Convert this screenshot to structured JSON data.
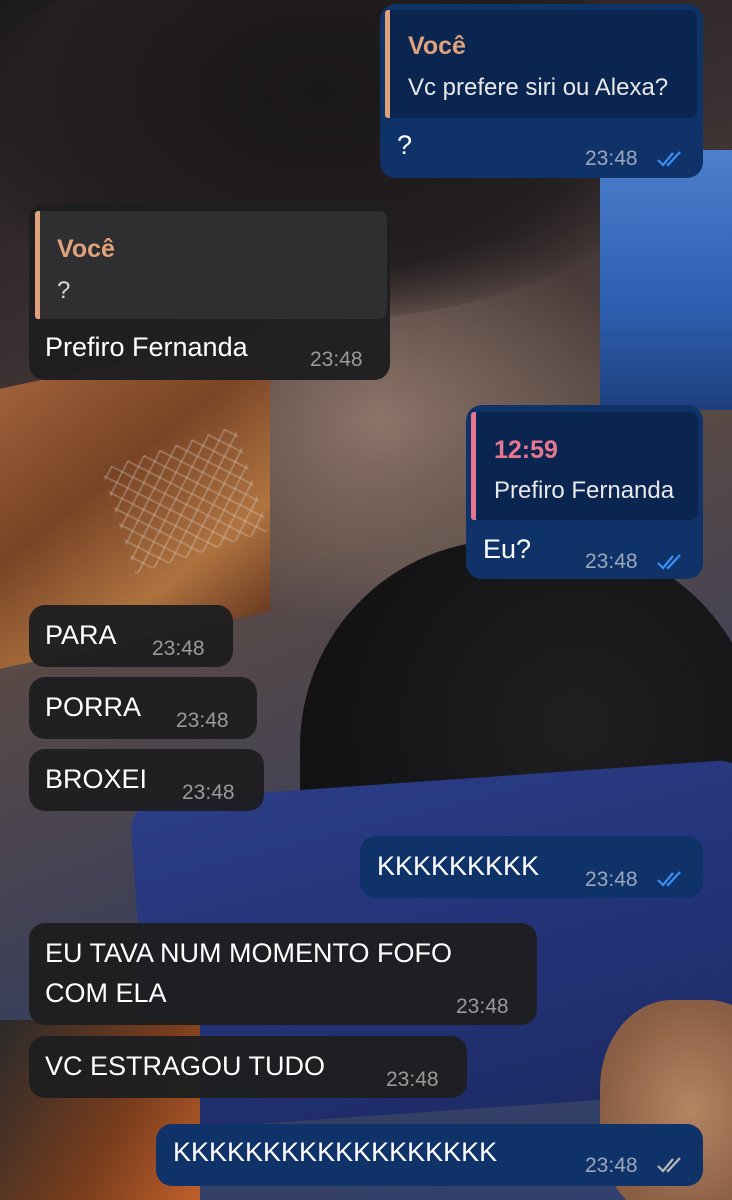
{
  "colors": {
    "incoming_bubble": "#1e1e20",
    "outgoing_bubble": "#0f3268",
    "quote_name_voce": "#e0a27a",
    "quote_name_time": "#e8768f",
    "read_ticks": "#3a8ff7",
    "delivered_ticks": "#b8b8b8"
  },
  "messages": [
    {
      "direction": "outgoing",
      "reply": {
        "name": "Você",
        "text": "Vc prefere siri ou Alexa?"
      },
      "text": "?",
      "time": "23:48",
      "status": "read"
    },
    {
      "direction": "incoming",
      "reply": {
        "name": "Você",
        "text": "?"
      },
      "text": "Prefiro Fernanda",
      "time": "23:48"
    },
    {
      "direction": "outgoing",
      "reply": {
        "name": "12:59",
        "text": "Prefiro Fernanda"
      },
      "text": "Eu?",
      "time": "23:48",
      "status": "read"
    },
    {
      "direction": "incoming",
      "text": "PARA",
      "time": "23:48"
    },
    {
      "direction": "incoming",
      "text": "PORRA",
      "time": "23:48"
    },
    {
      "direction": "incoming",
      "text": "BROXEI",
      "time": "23:48"
    },
    {
      "direction": "outgoing",
      "text": "KKKKKKKKK",
      "time": "23:48",
      "status": "read"
    },
    {
      "direction": "incoming",
      "text_line1": "EU TAVA NUM MOMENTO FOFO",
      "text_line2": "COM ELA",
      "time": "23:48"
    },
    {
      "direction": "incoming",
      "text": "VC ESTRAGOU TUDO",
      "time": "23:48"
    },
    {
      "direction": "outgoing",
      "text": "KKKKKKKKKKKKKKKKKK",
      "time": "23:48",
      "status": "delivered"
    }
  ]
}
